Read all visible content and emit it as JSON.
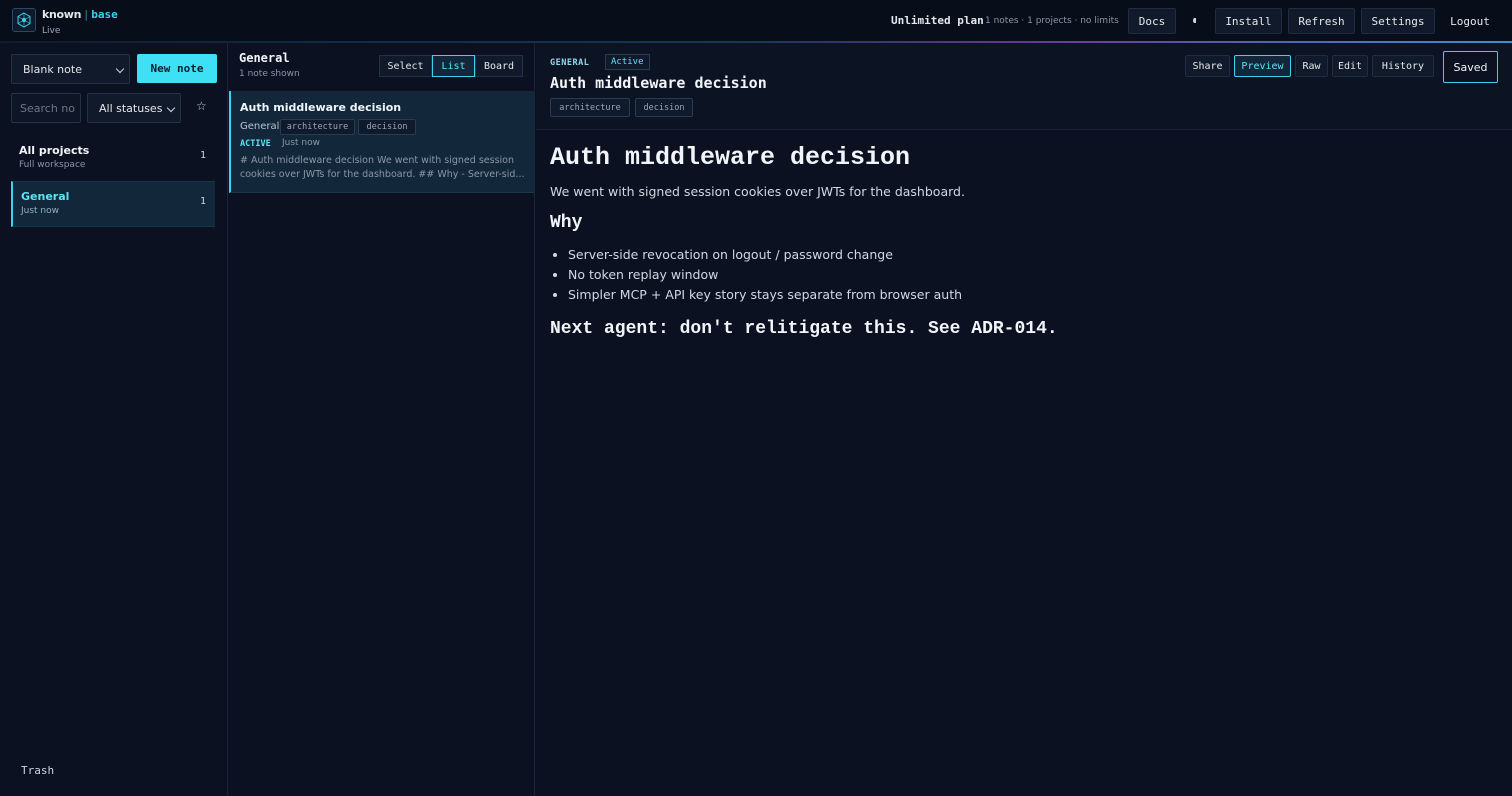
{
  "app": {
    "brand_first": "known",
    "brand_second": "base",
    "status": "Live"
  },
  "header": {
    "plan": "Unlimited plan",
    "plan_meta": "1 notes · 1 projects · no limits",
    "docs": "Docs",
    "install": "Install",
    "refresh": "Refresh",
    "settings": "Settings",
    "logout": "Logout"
  },
  "sidebar": {
    "template_select": "Blank note",
    "new_note": "New note",
    "search_placeholder": "Search no",
    "status_filter": "All statuses",
    "projects": [
      {
        "name": "All projects",
        "sub": "Full workspace",
        "count": "1"
      },
      {
        "name": "General",
        "sub": "Just now",
        "count": "1"
      }
    ],
    "trash": "Trash"
  },
  "list": {
    "title": "General",
    "sub": "1 note shown",
    "modes": [
      "Select",
      "List",
      "Board"
    ],
    "notes": [
      {
        "title": "Auth middleware decision",
        "project": "General",
        "tags": [
          "architecture",
          "decision"
        ],
        "status": "ACTIVE",
        "time": "Just now",
        "excerpt": "# Auth middleware decision We went with signed session cookies over JWTs for the dashboard. ## Why - Server-sid..."
      }
    ]
  },
  "detail": {
    "project": "GENERAL",
    "status": "Active",
    "title": "Auth middleware decision",
    "tags": [
      "architecture",
      "decision"
    ],
    "actions": [
      "Share",
      "Preview",
      "Raw",
      "Edit",
      "History"
    ],
    "saved": "Saved",
    "body": {
      "h1": "Auth middleware decision",
      "p": "We went with signed session cookies over JWTs for the dashboard.",
      "h2": "Why",
      "bullets": [
        "Server-side revocation on logout / password change",
        "No token replay window",
        "Simpler MCP + API key story stays separate from browser auth"
      ],
      "h3": "Next agent: don't relitigate this. See ADR-014."
    }
  },
  "colors": {
    "accent": "#3ee0f6",
    "background": "#0b1120",
    "active_row": "#12283a"
  },
  "icons": [
    "logo-icon",
    "chevron-down-icon",
    "star-icon",
    "theme-toggle-icon"
  ]
}
